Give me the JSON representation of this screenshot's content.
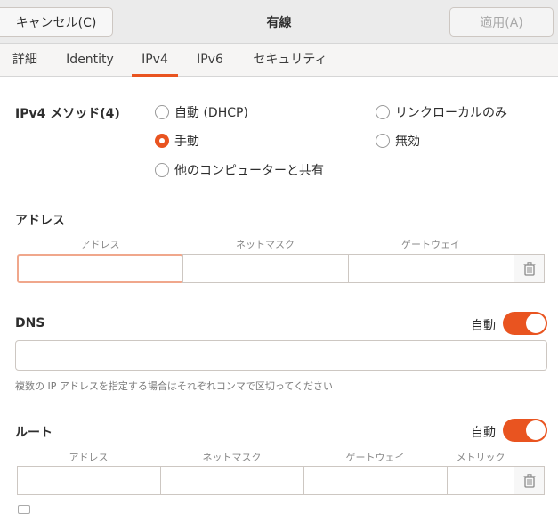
{
  "titlebar": {
    "cancel_label": "キャンセル(C)",
    "title": "有線",
    "apply_label": "適用(A)"
  },
  "tabs": [
    {
      "label": "詳細",
      "active": false
    },
    {
      "label": "Identity",
      "active": false
    },
    {
      "label": "IPv4",
      "active": true
    },
    {
      "label": "IPv6",
      "active": false
    },
    {
      "label": "セキュリティ",
      "active": false
    }
  ],
  "ipv4": {
    "method_label": "IPv4 メソッド(4)",
    "options": {
      "dhcp": "自動 (DHCP)",
      "link_local": "リンクローカルのみ",
      "manual": "手動",
      "disabled": "無効",
      "shared": "他のコンピューターと共有"
    },
    "selected": "手動"
  },
  "addresses": {
    "label": "アドレス",
    "columns": [
      "アドレス",
      "ネットマスク",
      "ゲートウェイ"
    ]
  },
  "dns": {
    "label": "DNS",
    "auto_label": "自動",
    "auto_on": true,
    "value": "",
    "hint": "複数の IP アドレスを指定する場合はそれぞれコンマで区切ってください"
  },
  "routes": {
    "label": "ルート",
    "auto_label": "自動",
    "auto_on": true,
    "columns": [
      "アドレス",
      "ネットマスク",
      "ゲートウェイ",
      "メトリック"
    ]
  },
  "colors": {
    "accent": "#e95420"
  }
}
